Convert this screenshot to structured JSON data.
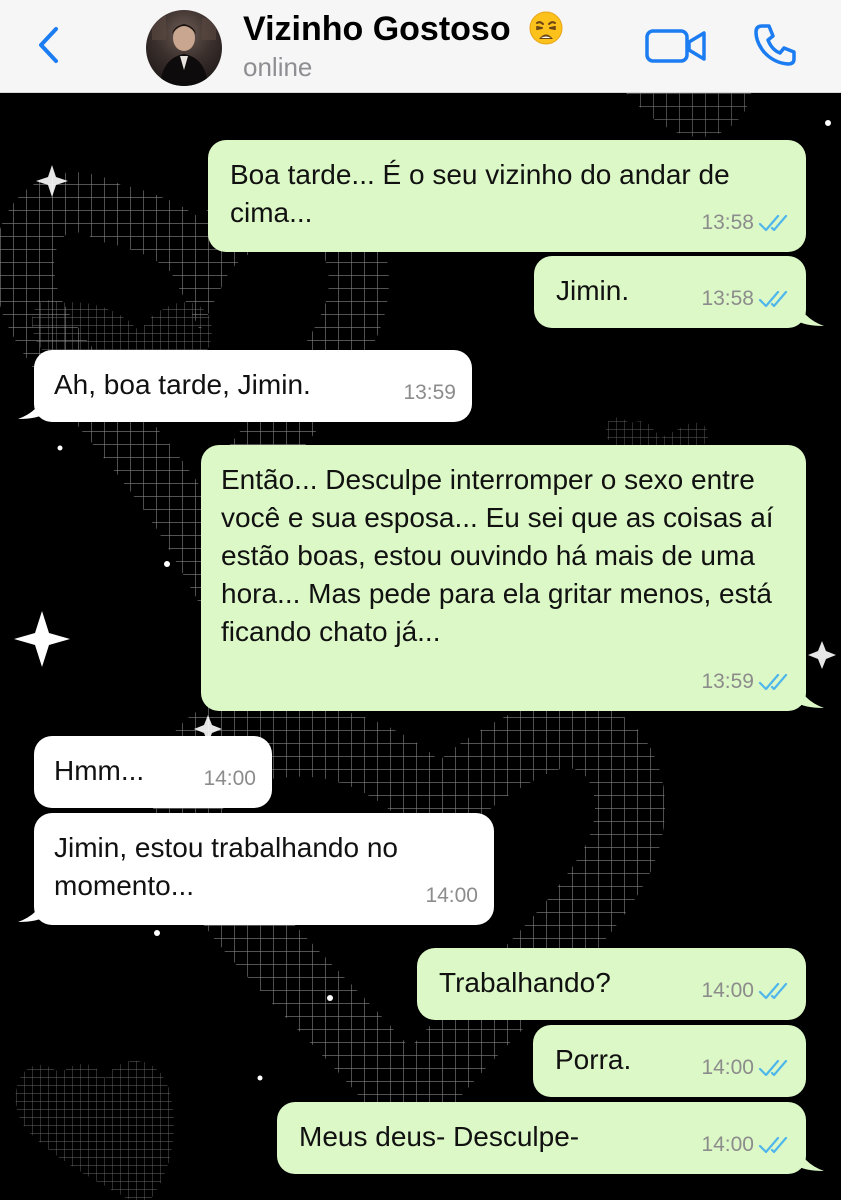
{
  "header": {
    "contact_name": "Vizinho Gostoso",
    "status": "online",
    "icons": {
      "back": "chevron-left-icon",
      "video": "video-camera-icon",
      "call": "phone-icon",
      "emoji": "weary-face-emoji"
    },
    "accent_color": "#1c7cf2"
  },
  "messages": [
    {
      "direction": "outgoing",
      "text": "Boa tarde... É o seu vizinho do andar de cima...",
      "time": "13:58",
      "read": true
    },
    {
      "direction": "outgoing",
      "text": "Jimin.",
      "time": "13:58",
      "read": true
    },
    {
      "direction": "incoming",
      "text": "Ah, boa tarde, Jimin.",
      "time": "13:59"
    },
    {
      "direction": "outgoing",
      "text": "Então... Desculpe interromper o sexo entre você e sua esposa... Eu sei que as coisas aí estão boas, estou ouvindo há mais de uma hora... Mas pede para ela gritar menos, está ficando chato já...",
      "time": "13:59",
      "read": true
    },
    {
      "direction": "incoming",
      "text": "Hmm...",
      "time": "14:00"
    },
    {
      "direction": "incoming",
      "text": "Jimin, estou trabalhando no momento...",
      "time": "14:00"
    },
    {
      "direction": "outgoing",
      "text": "Trabalhando?",
      "time": "14:00",
      "read": true
    },
    {
      "direction": "outgoing",
      "text": "Porra.",
      "time": "14:00",
      "read": true
    },
    {
      "direction": "outgoing",
      "text": "Meus deus- Desculpe-",
      "time": "14:00",
      "read": true
    }
  ],
  "colors": {
    "outgoing_bubble": "#dcf8c6",
    "incoming_bubble": "#ffffff",
    "read_ticks": "#4fb6ec",
    "chat_background": "#000000"
  }
}
